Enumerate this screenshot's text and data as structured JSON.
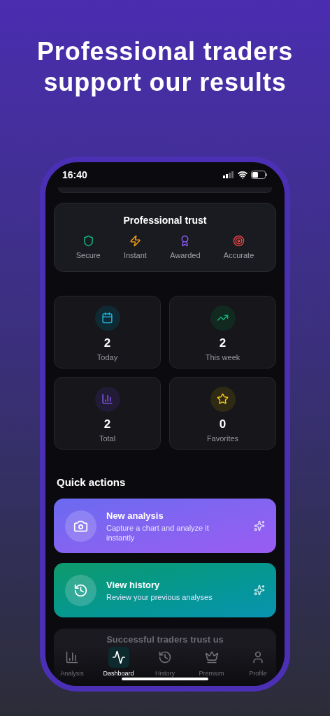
{
  "headline": "Professional traders support our results",
  "status_bar": {
    "time": "16:40"
  },
  "trust": {
    "title": "Professional trust",
    "items": [
      {
        "label": "Secure",
        "kind": "shield",
        "color": "#10b981"
      },
      {
        "label": "Instant",
        "kind": "bolt",
        "color": "#f59e0b"
      },
      {
        "label": "Awarded",
        "kind": "award",
        "color": "#8b5cf6"
      },
      {
        "label": "Accurate",
        "kind": "target",
        "color": "#ef4444"
      }
    ]
  },
  "stats": [
    {
      "value": "2",
      "label": "Today",
      "kind": "calendar"
    },
    {
      "value": "2",
      "label": "This week",
      "kind": "trend"
    },
    {
      "value": "2",
      "label": "Total",
      "kind": "bars"
    },
    {
      "value": "0",
      "label": "Favorites",
      "kind": "star"
    }
  ],
  "quick_actions": {
    "title": "Quick actions",
    "items": [
      {
        "title": "New analysis",
        "subtitle": "Capture a chart and analyze it instantly",
        "kind": "camera"
      },
      {
        "title": "View history",
        "subtitle": "Review your previous analyses",
        "kind": "history"
      }
    ]
  },
  "hidden_card": {
    "title": "Successful traders trust us"
  },
  "tab_bar": [
    {
      "label": "Analysis",
      "kind": "bars",
      "selected": false
    },
    {
      "label": "Dashboard",
      "kind": "activity",
      "selected": true
    },
    {
      "label": "History",
      "kind": "history",
      "selected": false
    },
    {
      "label": "Premium",
      "kind": "crown",
      "selected": false
    },
    {
      "label": "Profile",
      "kind": "user",
      "selected": false
    }
  ]
}
